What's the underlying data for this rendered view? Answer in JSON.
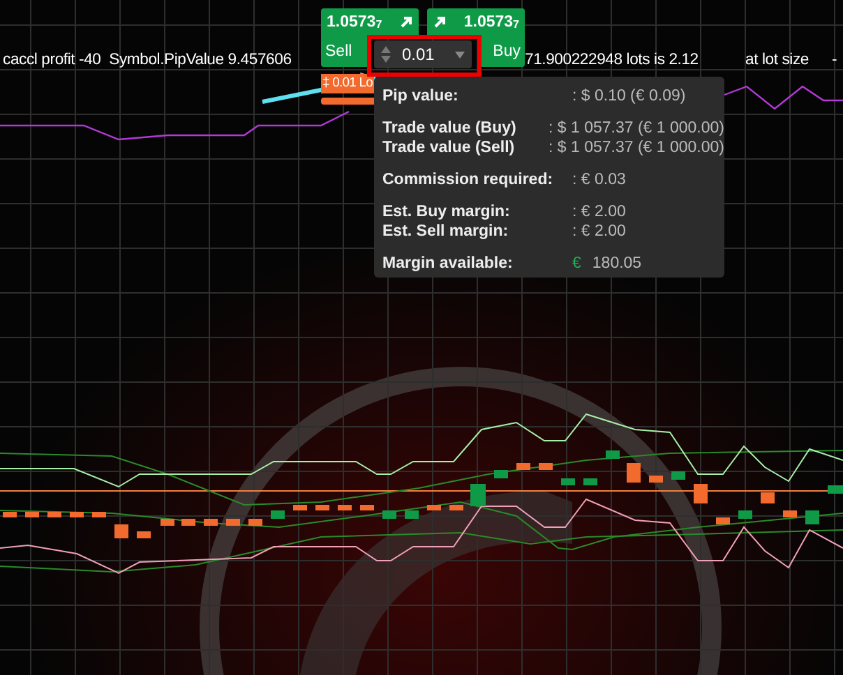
{
  "log_texts": [
    "caccl profit -40  Symbol.PipValue 9.457606",
    "71.900222948 lots is 2.12",
    "at lot size",
    "-"
  ],
  "trade_widget": {
    "sell": {
      "price": "1.0573$_{7}$",
      "label": "Sell"
    },
    "buy": {
      "price": "1.0573$_{7}$",
      "label": "Buy"
    },
    "lot_field": {
      "value": "0.01",
      "highlighted": true
    }
  },
  "order_tag": "‡ 0.01 Lo",
  "info_popup": {
    "groups": [
      [
        {
          "kind": "text",
          "label": "Pip value:",
          "value": ": $ 0.10 (€ 0.09)"
        }
      ],
      [
        {
          "kind": "text",
          "label": "Trade value (Buy)",
          "value": ": $ 1 057.37 (€ 1 000.00)"
        },
        {
          "kind": "text",
          "label": "Trade value (Sell)",
          "value": ": $ 1 057.37 (€ 1 000.00)"
        }
      ],
      [
        {
          "kind": "text",
          "label": "Commission required:",
          "value": ": € 0.03"
        }
      ],
      [
        {
          "kind": "text",
          "label": "Est. Buy margin:",
          "value": ": € 2.00"
        },
        {
          "kind": "text",
          "label": "Est. Sell margin:",
          "value": ": € 2.00"
        }
      ],
      [
        {
          "kind": "money",
          "label": "Margin available:",
          "currency": "€",
          "amount": "180.05"
        }
      ]
    ]
  }
}
